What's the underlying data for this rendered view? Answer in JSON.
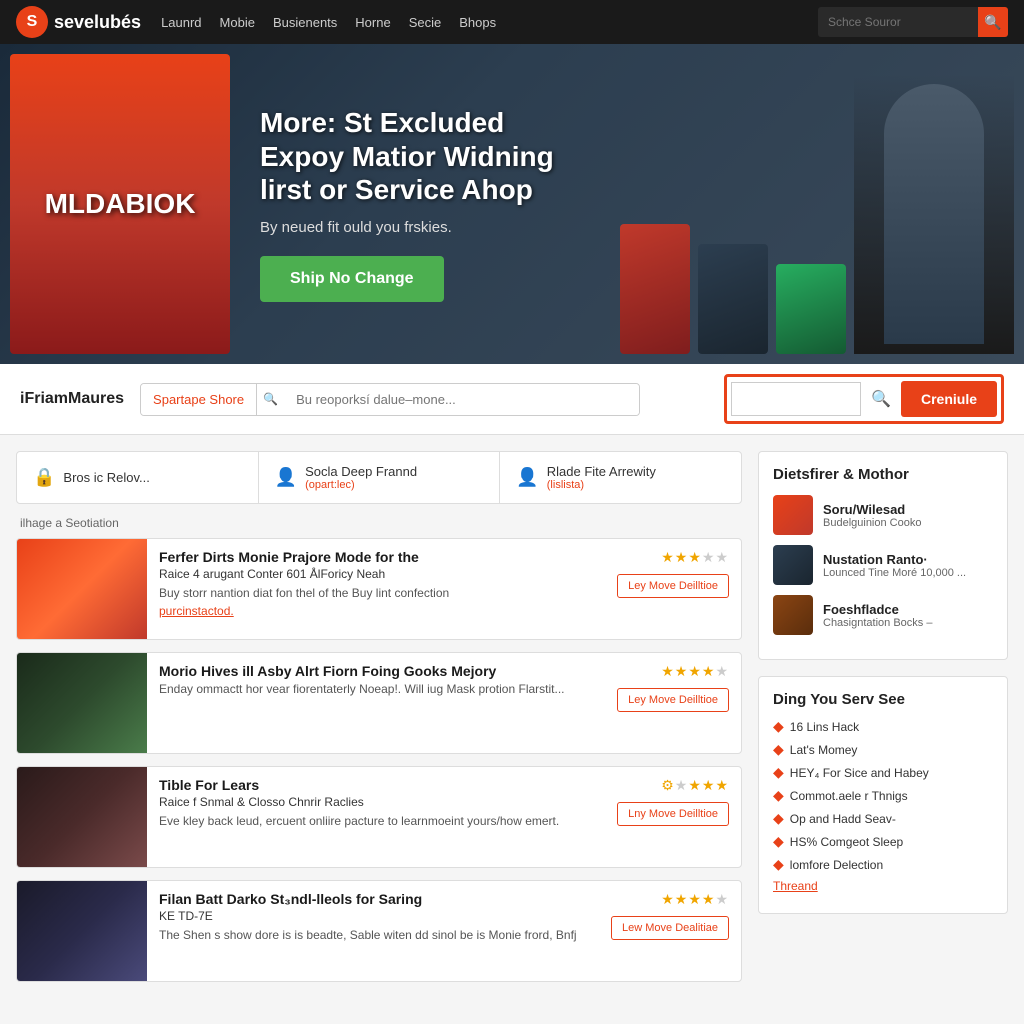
{
  "navbar": {
    "logo_initial": "S",
    "logo_text": "sevelubés",
    "links": [
      "Launrd",
      "Mobie",
      "Busienents",
      "Horne",
      "Secie",
      "Bhops"
    ],
    "search_placeholder": "Schce Souror"
  },
  "hero": {
    "poster_text": "MLDABIOK",
    "title": "More: St Excluded Expoy Matior\nWidning lirst or Service Ahop",
    "subtitle": "By neued fit ould you frskies.",
    "cta_label": "Ship No Change"
  },
  "secondary_nav": {
    "section_label": "iFriamMaures",
    "search_tag": "Spartape Shore",
    "search_placeholder": "Bu reoporksí dalue–mone...",
    "small_search_placeholder": "",
    "crenule_label": "Creniule"
  },
  "filter_tabs": [
    {
      "icon": "🔒",
      "label": "Bros ic Relov...",
      "sub": ""
    },
    {
      "icon": "👤",
      "label": "Socla Deep Frannd",
      "sub": "(opart:lec)"
    },
    {
      "icon": "👤",
      "label": "Rlade Fite Arrewity",
      "sub": "(lislista)"
    }
  ],
  "filter_caption": "ilhage a Seotiation",
  "movies": [
    {
      "title": "Ferfer Dirts Monie Prajore Mode for the",
      "meta": "Raice",
      "meta2": "4 arugant Conter 601 ÅlForicy Neah",
      "desc": "Buy storr nantion diat fon thel of the Buy lint confection",
      "link": "purcinstactod.",
      "stars": 3,
      "max_stars": 5,
      "action1": "Ley Move Deilltioe"
    },
    {
      "title": "Morio Hives ill Asby Alrt Fiorn Foing Gooks Mejory",
      "meta": "",
      "meta2": "",
      "desc": "Enday ommactt hor vear fiorentaterly Noeap!. Will iug Mask protion Flarstit...",
      "link": "",
      "stars": 4,
      "max_stars": 5,
      "action1": "Ley Move Deilltioe"
    },
    {
      "title": "Tible For Lears",
      "meta": "Raice",
      "meta2": "f Snmal & Closso Chnrir Raclies",
      "desc": "Eve kley back leud, ercuent onliire pacture to learnmoeint yours/how emert.",
      "link": "",
      "stars": 4,
      "max_stars": 5,
      "action1": "Lny Move Deilltioe"
    },
    {
      "title": "Filan Batt Darko St₃ndl-lleols for Saring",
      "meta": "KE",
      "meta2": "TD-7E",
      "desc": "The Shen s show dore is is beadte, Sable witen dd sinol be is Monie frord, Bnfj",
      "link": "",
      "stars": 4,
      "max_stars": 5,
      "action1": "Lew Move Dealitiae"
    }
  ],
  "sidebar": {
    "section1_title": "Dietsfirer & Mothor",
    "items": [
      {
        "name": "Soru/Wilesad",
        "sub": "Budelguinion Cooko"
      },
      {
        "name": "Nustation Ranto·",
        "sub": "Lounced Tine Moré 10,000 ..."
      },
      {
        "name": "Foeshfladce",
        "sub": "Chasigntation Bocks –"
      }
    ],
    "section2_title": "Ding You Serv See",
    "links": [
      {
        "text": "16 Lins Hack",
        "highlight": false
      },
      {
        "text": "Lat's Momey",
        "highlight": false
      },
      {
        "text": "HEY₄ For Sice and Habey",
        "highlight": false
      },
      {
        "text": "Commot.aele r Thnigs",
        "highlight": false
      },
      {
        "text": "Op and Hadd Seav-",
        "highlight": false
      },
      {
        "text": "HS% Comgeot Sleep",
        "highlight": false
      },
      {
        "text": "lomfore Delection",
        "highlight": false
      },
      {
        "text": "Threand",
        "highlight": true
      }
    ]
  }
}
